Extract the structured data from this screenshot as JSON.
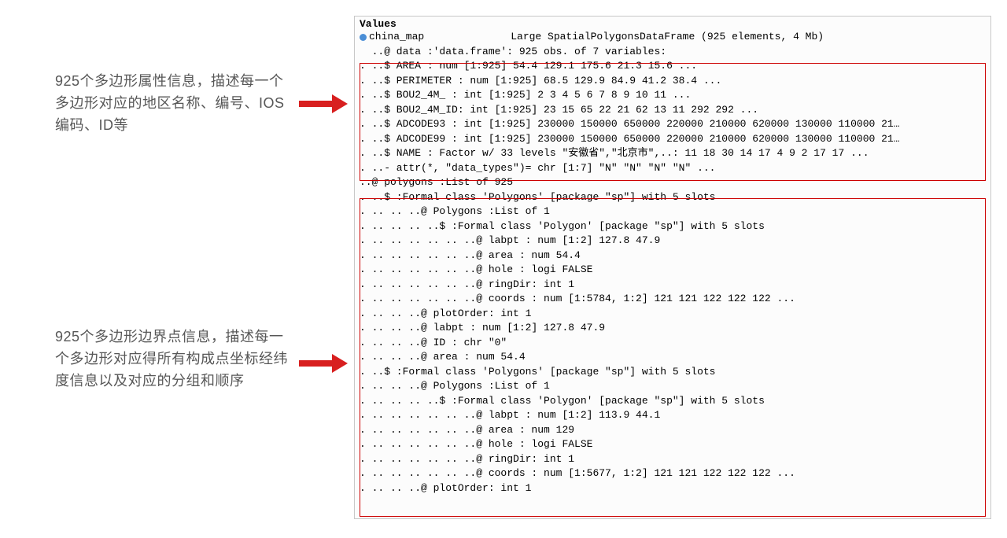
{
  "annot1": "925个多边形属性信息，描述每一个多边形对应的地区名称、编号、IOS编码、ID等",
  "annot2": "925个多边形边界点信息，描述每一个多边形对应得所有构成点坐标经纬度信息以及对应的分组和顺序",
  "panel": {
    "header": "Values",
    "objName": "china_map",
    "objDesc": "Large SpatialPolygonsDataFrame (925 elements, 4 Mb)",
    "lines": [
      "  ..@ data :'data.frame': 925 obs. of 7 variables:",
      ". ..$ AREA : num [1:925] 54.4 129.1 175.6 21.3 15.6 ...",
      ". ..$ PERIMETER : num [1:925] 68.5 129.9 84.9 41.2 38.4 ...",
      ". ..$ BOU2_4M_ : int [1:925] 2 3 4 5 6 7 8 9 10 11 ...",
      ". ..$ BOU2_4M_ID: int [1:925] 23 15 65 22 21 62 13 11 292 292 ...",
      ". ..$ ADCODE93 : int [1:925] 230000 150000 650000 220000 210000 620000 130000 110000 21…",
      ". ..$ ADCODE99 : int [1:925] 230000 150000 650000 220000 210000 620000 130000 110000 21…",
      ". ..$ NAME : Factor w/ 33 levels \"安徽省\",\"北京市\",..: 11 18 30 14 17 4 9 2 17 17 ...",
      ". ..- attr(*, \"data_types\")= chr [1:7] \"N\" \"N\" \"N\" \"N\" ...",
      "..@ polygons :List of 925",
      ". ..$ :Formal class 'Polygons' [package \"sp\"] with 5 slots",
      ". .. .. ..@ Polygons :List of 1",
      ". .. .. .. ..$ :Formal class 'Polygon' [package \"sp\"] with 5 slots",
      ". .. .. .. .. .. ..@ labpt : num [1:2] 127.8 47.9",
      ". .. .. .. .. .. ..@ area : num 54.4",
      ". .. .. .. .. .. ..@ hole : logi FALSE",
      ". .. .. .. .. .. ..@ ringDir: int 1",
      ". .. .. .. .. .. ..@ coords : num [1:5784, 1:2] 121 121 122 122 122 ...",
      ". .. .. ..@ plotOrder: int 1",
      ". .. .. ..@ labpt : num [1:2] 127.8 47.9",
      ". .. .. ..@ ID : chr \"0\"",
      ". .. .. ..@ area : num 54.4",
      ". ..$ :Formal class 'Polygons' [package \"sp\"] with 5 slots",
      ". .. .. ..@ Polygons :List of 1",
      ". .. .. .. ..$ :Formal class 'Polygon' [package \"sp\"] with 5 slots",
      ". .. .. .. .. .. ..@ labpt : num [1:2] 113.9 44.1",
      ". .. .. .. .. .. ..@ area : num 129",
      ". .. .. .. .. .. ..@ hole : logi FALSE",
      ". .. .. .. .. .. ..@ ringDir: int 1",
      ". .. .. .. .. .. ..@ coords : num [1:5677, 1:2] 121 121 122 122 122 ...",
      ". .. .. ..@ plotOrder: int 1"
    ]
  }
}
